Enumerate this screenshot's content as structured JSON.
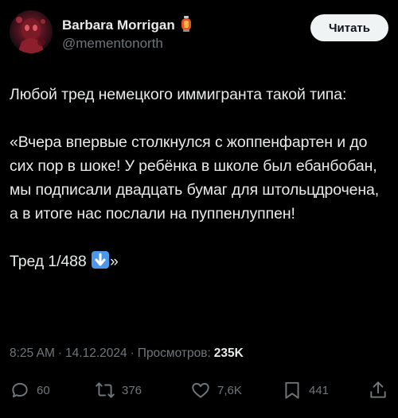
{
  "author": {
    "display_name": "Barbara Morrigan",
    "handle": "@mementonorth",
    "badge_icon": "lantern-emoji-icon"
  },
  "follow_button": {
    "label": "Читать"
  },
  "post": {
    "text_intro": "Любой тред немецкого иммигранта такой типа:",
    "text_quote": "«Вчера впервые столкнулся с жоппенфартен и до сих пор в шоке! У ребёнка в школе был ебанбобан, мы подписали двадцать бумаг для штольцдрочена, а в итоге нас послали на пуппенлуппен!",
    "text_thread_prefix": "Тред 1/488",
    "text_thread_emoji": "down-arrow-emoji-icon",
    "text_thread_suffix": "»"
  },
  "meta": {
    "time": "8:25 AM",
    "separator": "·",
    "date": "14.12.2024",
    "views_label": "Просмотров:",
    "views_count": "235K"
  },
  "actions": {
    "replies": "60",
    "reposts": "376",
    "likes": "7,6K",
    "bookmarks": "441"
  },
  "colors": {
    "background": "#000000",
    "text_primary": "#e7e9ea",
    "text_secondary": "#71767b",
    "button_bg": "#eff3f4",
    "emoji_blue": "#4d97e8"
  }
}
